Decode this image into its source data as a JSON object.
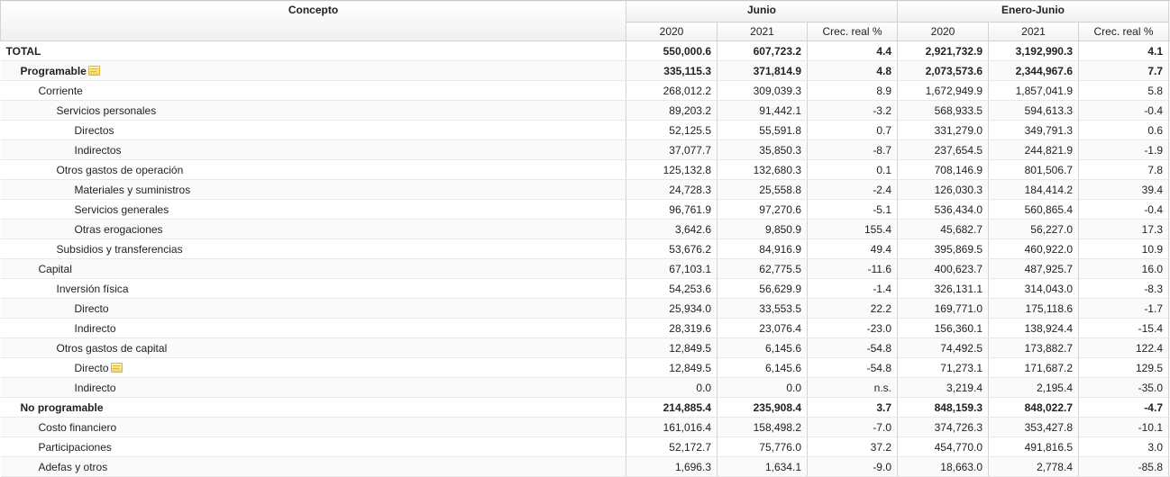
{
  "header": {
    "concept_label": "Concepto",
    "group1": "Junio",
    "group2": "Enero-Junio",
    "y2020": "2020",
    "y2021": "2021",
    "growth": "Crec. real %"
  },
  "rows": [
    {
      "label": "TOTAL",
      "level": 0,
      "bold": true,
      "note": false,
      "v": [
        "550,000.6",
        "607,723.2",
        "4.4",
        "2,921,732.9",
        "3,192,990.3",
        "4.1"
      ]
    },
    {
      "label": "Programable",
      "level": 1,
      "bold": true,
      "note": true,
      "v": [
        "335,115.3",
        "371,814.9",
        "4.8",
        "2,073,573.6",
        "2,344,967.6",
        "7.7"
      ]
    },
    {
      "label": "Corriente",
      "level": 2,
      "bold": false,
      "note": false,
      "v": [
        "268,012.2",
        "309,039.3",
        "8.9",
        "1,672,949.9",
        "1,857,041.9",
        "5.8"
      ]
    },
    {
      "label": "Servicios personales",
      "level": 3,
      "bold": false,
      "note": false,
      "v": [
        "89,203.2",
        "91,442.1",
        "-3.2",
        "568,933.5",
        "594,613.3",
        "-0.4"
      ]
    },
    {
      "label": "Directos",
      "level": 4,
      "bold": false,
      "note": false,
      "v": [
        "52,125.5",
        "55,591.8",
        "0.7",
        "331,279.0",
        "349,791.3",
        "0.6"
      ]
    },
    {
      "label": "Indirectos",
      "level": 4,
      "bold": false,
      "note": false,
      "v": [
        "37,077.7",
        "35,850.3",
        "-8.7",
        "237,654.5",
        "244,821.9",
        "-1.9"
      ]
    },
    {
      "label": "Otros gastos de operación",
      "level": 3,
      "bold": false,
      "note": false,
      "v": [
        "125,132.8",
        "132,680.3",
        "0.1",
        "708,146.9",
        "801,506.7",
        "7.8"
      ]
    },
    {
      "label": "Materiales y suministros",
      "level": 4,
      "bold": false,
      "note": false,
      "v": [
        "24,728.3",
        "25,558.8",
        "-2.4",
        "126,030.3",
        "184,414.2",
        "39.4"
      ]
    },
    {
      "label": "Servicios generales",
      "level": 4,
      "bold": false,
      "note": false,
      "v": [
        "96,761.9",
        "97,270.6",
        "-5.1",
        "536,434.0",
        "560,865.4",
        "-0.4"
      ]
    },
    {
      "label": "Otras erogaciones",
      "level": 4,
      "bold": false,
      "note": false,
      "v": [
        "3,642.6",
        "9,850.9",
        "155.4",
        "45,682.7",
        "56,227.0",
        "17.3"
      ]
    },
    {
      "label": "Subsidios y transferencias",
      "level": 3,
      "bold": false,
      "note": false,
      "v": [
        "53,676.2",
        "84,916.9",
        "49.4",
        "395,869.5",
        "460,922.0",
        "10.9"
      ]
    },
    {
      "label": "Capital",
      "level": 2,
      "bold": false,
      "note": false,
      "v": [
        "67,103.1",
        "62,775.5",
        "-11.6",
        "400,623.7",
        "487,925.7",
        "16.0"
      ]
    },
    {
      "label": "Inversión física",
      "level": 3,
      "bold": false,
      "note": false,
      "v": [
        "54,253.6",
        "56,629.9",
        "-1.4",
        "326,131.1",
        "314,043.0",
        "-8.3"
      ]
    },
    {
      "label": "Directo",
      "level": 4,
      "bold": false,
      "note": false,
      "v": [
        "25,934.0",
        "33,553.5",
        "22.2",
        "169,771.0",
        "175,118.6",
        "-1.7"
      ]
    },
    {
      "label": "Indirecto",
      "level": 4,
      "bold": false,
      "note": false,
      "v": [
        "28,319.6",
        "23,076.4",
        "-23.0",
        "156,360.1",
        "138,924.4",
        "-15.4"
      ]
    },
    {
      "label": "Otros gastos de capital",
      "level": 3,
      "bold": false,
      "note": false,
      "v": [
        "12,849.5",
        "6,145.6",
        "-54.8",
        "74,492.5",
        "173,882.7",
        "122.4"
      ]
    },
    {
      "label": "Directo",
      "level": 4,
      "bold": false,
      "note": true,
      "v": [
        "12,849.5",
        "6,145.6",
        "-54.8",
        "71,273.1",
        "171,687.2",
        "129.5"
      ]
    },
    {
      "label": "Indirecto",
      "level": 4,
      "bold": false,
      "note": false,
      "v": [
        "0.0",
        "0.0",
        "n.s.",
        "3,219.4",
        "2,195.4",
        "-35.0"
      ]
    },
    {
      "label": "No programable",
      "level": 1,
      "bold": true,
      "note": false,
      "v": [
        "214,885.4",
        "235,908.4",
        "3.7",
        "848,159.3",
        "848,022.7",
        "-4.7"
      ]
    },
    {
      "label": "Costo financiero",
      "level": 2,
      "bold": false,
      "note": false,
      "v": [
        "161,016.4",
        "158,498.2",
        "-7.0",
        "374,726.3",
        "353,427.8",
        "-10.1"
      ]
    },
    {
      "label": "Participaciones",
      "level": 2,
      "bold": false,
      "note": false,
      "v": [
        "52,172.7",
        "75,776.0",
        "37.2",
        "454,770.0",
        "491,816.5",
        "3.0"
      ]
    },
    {
      "label": "Adefas y otros",
      "level": 2,
      "bold": false,
      "note": false,
      "v": [
        "1,696.3",
        "1,634.1",
        "-9.0",
        "18,663.0",
        "2,778.4",
        "-85.8"
      ]
    }
  ]
}
